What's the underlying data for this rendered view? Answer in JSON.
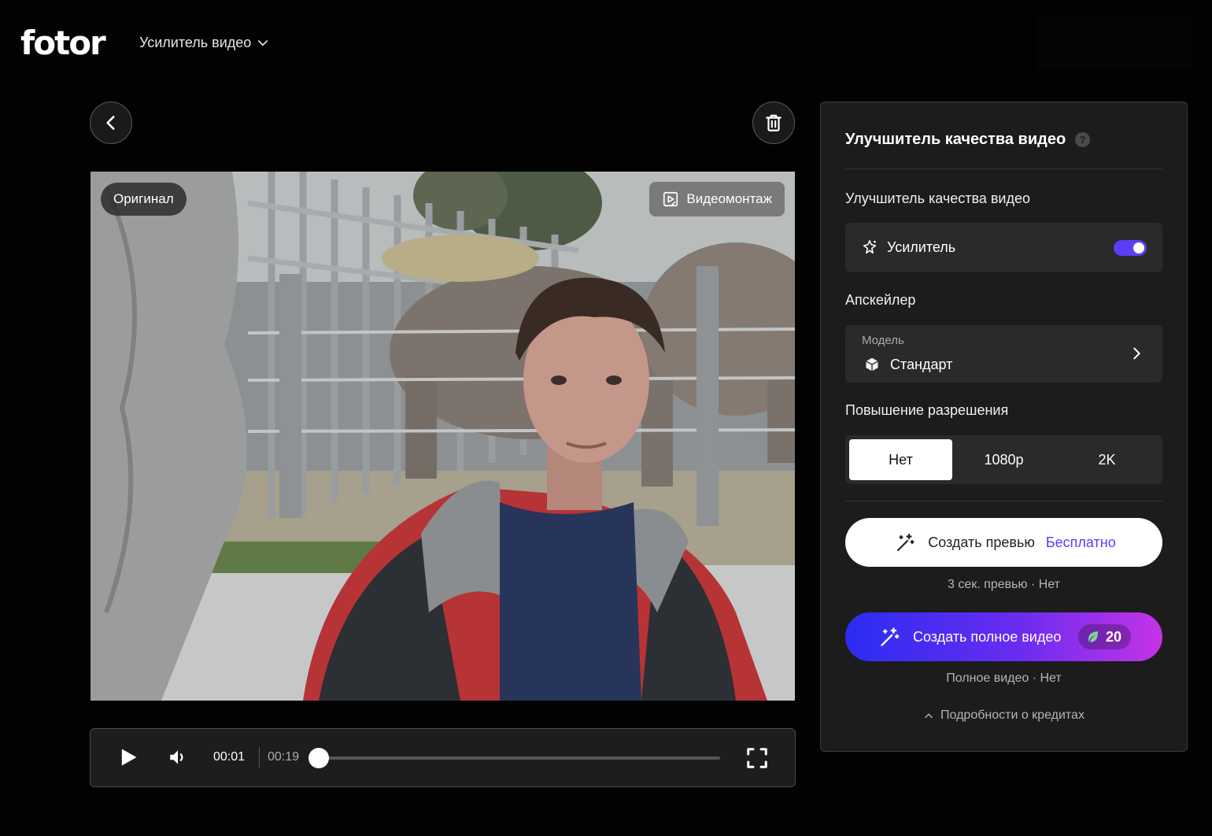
{
  "header": {
    "logo": "fotor",
    "tool_menu_label": "Усилитель видео"
  },
  "video": {
    "original_badge": "Оригинал",
    "montage_button": "Видеомонтаж"
  },
  "player": {
    "current_time": "00:01",
    "total_time": "00:19",
    "progress": 0.0
  },
  "panel": {
    "title": "Улучшитель качества видео",
    "help_icon": "?",
    "enhancer_section_label": "Улучшитель качества видео",
    "enhancer_label": "Усилитель",
    "enhancer_enabled": true,
    "upscaler_section_label": "Апскейлер",
    "model_caption": "Модель",
    "model_value": "Стандарт",
    "resolution_section_label": "Повышение разрешения",
    "resolution_options": [
      "Нет",
      "1080p",
      "2K"
    ],
    "resolution_selected": "Нет",
    "preview_button_label": "Создать превью",
    "preview_button_free": "Бесплатно",
    "preview_note": "3 сек. превью · Нет",
    "full_button_label": "Создать полное видео",
    "full_button_credits": "20",
    "full_note": "Полное видео · Нет",
    "credits_details_link": "Подробности о кредитах"
  },
  "colors": {
    "accent": "#5b3df5",
    "gradient_start": "#2b2cf2",
    "gradient_end": "#c534e6"
  }
}
